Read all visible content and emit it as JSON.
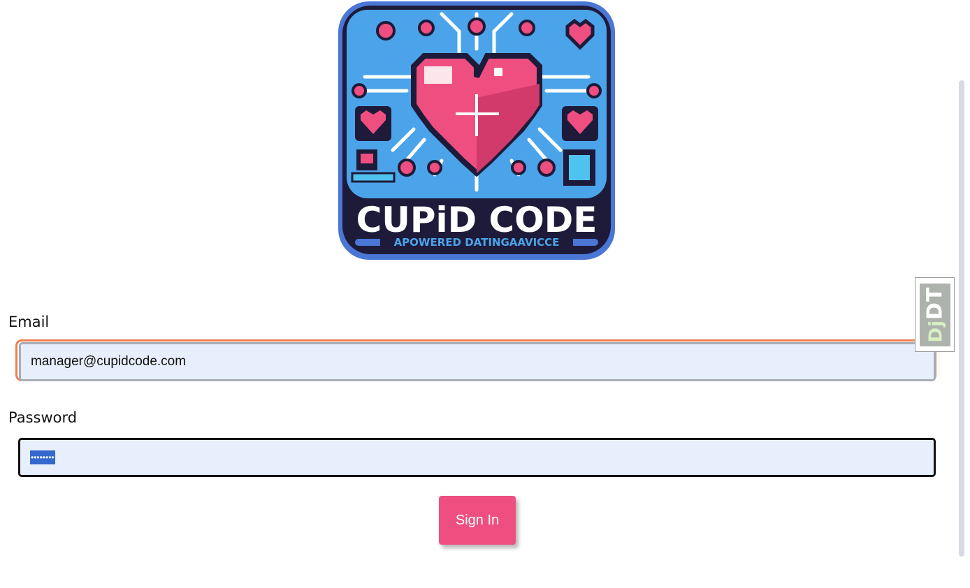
{
  "logo": {
    "title": "CUPiD CODE",
    "tagline": "APOWERED DATINGAAVICCE"
  },
  "form": {
    "email_label": "Email",
    "email_value": "manager@cupidcode.com",
    "password_label": "Password",
    "password_masked": "••••••••",
    "submit_label": "Sign In"
  },
  "toolbar": {
    "handle_prefix": "Dj",
    "handle_suffix": "DT"
  },
  "colors": {
    "accent": "#ee4f80",
    "focus_ring": "#ef7f4f",
    "input_bg": "#e8effc"
  }
}
